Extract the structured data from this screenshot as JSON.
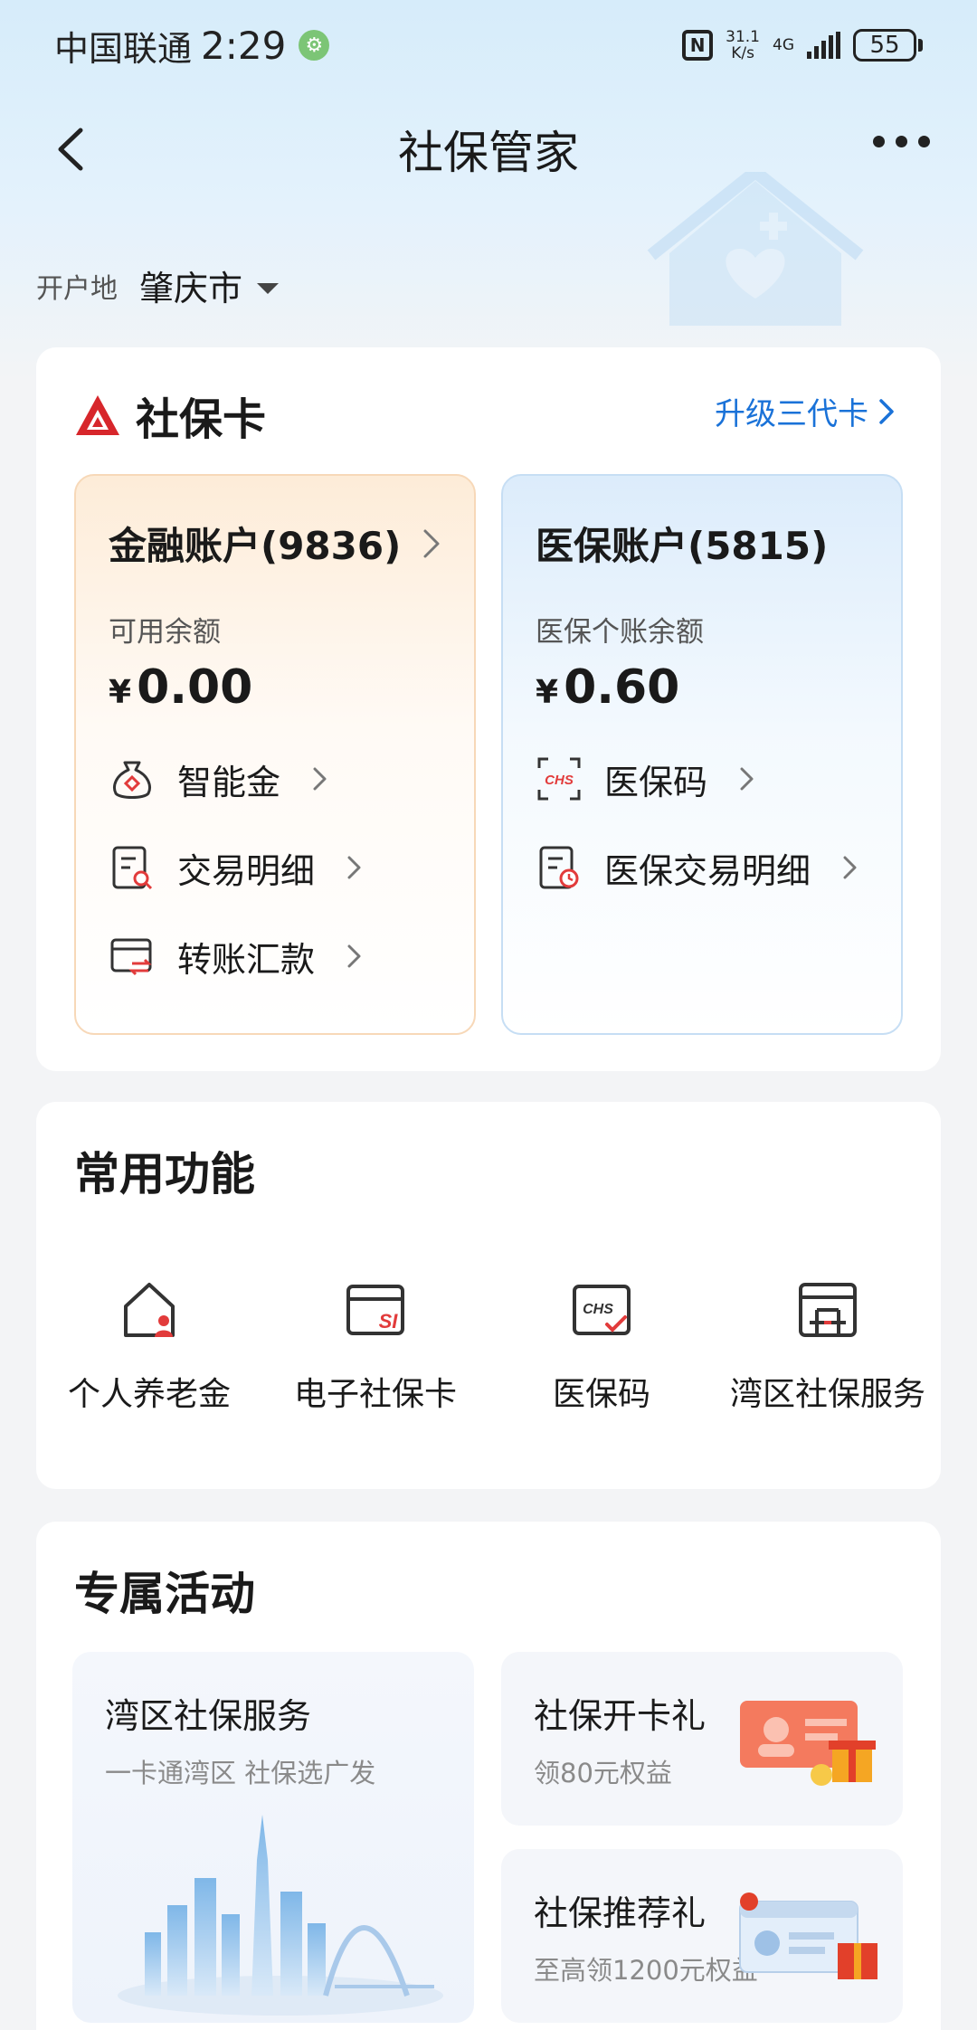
{
  "status_bar": {
    "carrier": "中国联通",
    "time": "2:29",
    "nfc": "N",
    "speed_value": "31.1",
    "speed_unit": "K/s",
    "network": "4G",
    "battery": "55"
  },
  "nav": {
    "title": "社保管家"
  },
  "location": {
    "label": "开户地",
    "city": "肇庆市"
  },
  "social_card": {
    "title": "社保卡",
    "upgrade_link": "升级三代卡",
    "financial": {
      "title": "金融账户(9836)",
      "balance_label": "可用余额",
      "currency": "¥",
      "balance": "0.00",
      "items": [
        {
          "label": "智能金",
          "icon": "money-bag-icon"
        },
        {
          "label": "交易明细",
          "icon": "transaction-detail-icon"
        },
        {
          "label": "转账汇款",
          "icon": "transfer-icon"
        }
      ]
    },
    "medical": {
      "title": "医保账户(5815)",
      "balance_label": "医保个账余额",
      "currency": "¥",
      "balance": "0.60",
      "items": [
        {
          "label": "医保码",
          "icon": "chs-scan-icon"
        },
        {
          "label": "医保交易明细",
          "icon": "medical-transaction-icon"
        }
      ]
    }
  },
  "common_functions": {
    "title": "常用功能",
    "items": [
      {
        "label": "个人养老金",
        "icon": "pension-house-icon"
      },
      {
        "label": "电子社保卡",
        "icon": "si-card-icon"
      },
      {
        "label": "医保码",
        "icon": "chs-check-icon"
      },
      {
        "label": "湾区社保服务",
        "icon": "bridge-window-icon"
      }
    ]
  },
  "activities": {
    "title": "专属活动",
    "big": {
      "title": "湾区社保服务",
      "subtitle": "一卡通湾区 社保选广发"
    },
    "small": [
      {
        "title": "社保开卡礼",
        "subtitle": "领80元权益"
      },
      {
        "title": "社保推荐礼",
        "subtitle": "至高领1200元权益"
      }
    ]
  },
  "colors": {
    "accent_blue": "#1a72d8",
    "brand_red": "#d7262b",
    "finance_border": "#f7d8b8",
    "medical_border": "#c6def4"
  }
}
